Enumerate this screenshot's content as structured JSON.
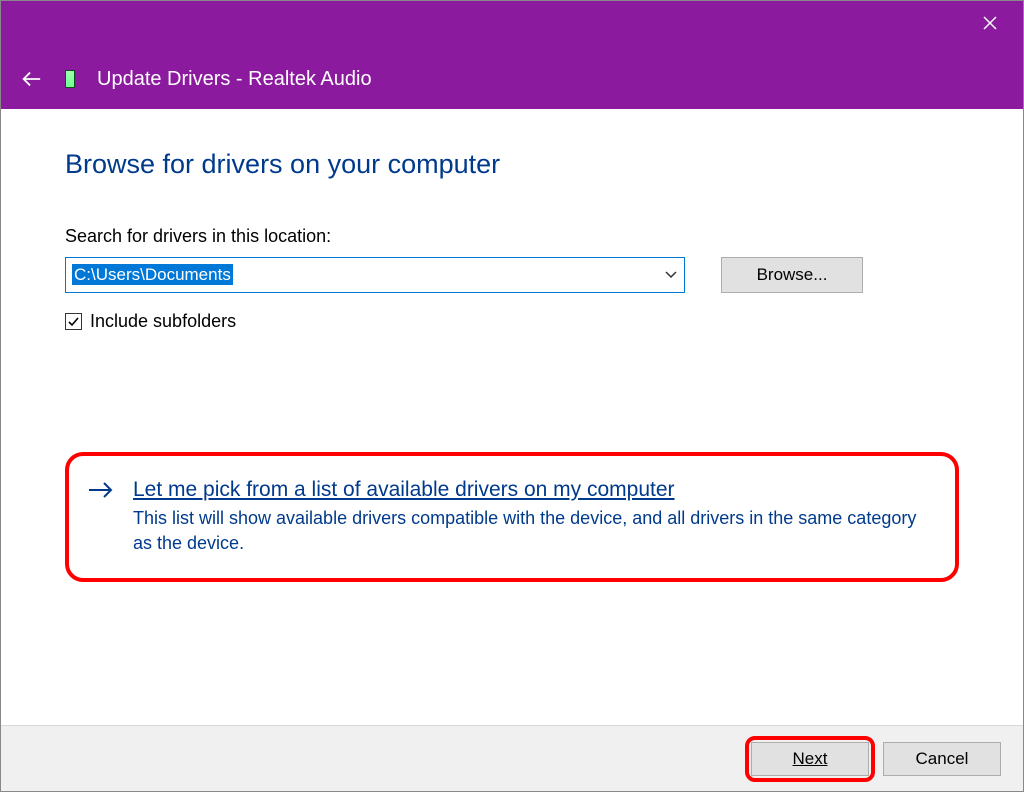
{
  "titlebar": {
    "title": "Update Drivers - Realtek Audio"
  },
  "main": {
    "heading": "Browse for drivers on your computer",
    "search_label": "Search for drivers in this location:",
    "path_value": "C:\\Users\\Documents",
    "browse_label": "Browse...",
    "include_subfolders_label": "Include subfolders",
    "include_subfolders_checked": true
  },
  "option": {
    "title": "Let me pick from a list of available drivers on my computer",
    "description": "This list will show available drivers compatible with the device, and all drivers in the same category as the device."
  },
  "footer": {
    "next_label": "Next",
    "cancel_label": "Cancel"
  }
}
